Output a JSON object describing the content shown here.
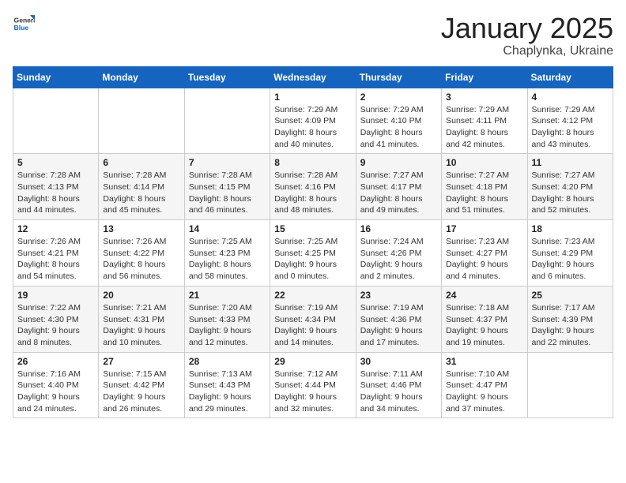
{
  "header": {
    "logo_general": "General",
    "logo_blue": "Blue",
    "month_year": "January 2025",
    "location": "Chaplynka, Ukraine"
  },
  "days_of_week": [
    "Sunday",
    "Monday",
    "Tuesday",
    "Wednesday",
    "Thursday",
    "Friday",
    "Saturday"
  ],
  "weeks": [
    [
      {
        "day": "",
        "info": ""
      },
      {
        "day": "",
        "info": ""
      },
      {
        "day": "",
        "info": ""
      },
      {
        "day": "1",
        "info": "Sunrise: 7:29 AM\nSunset: 4:09 PM\nDaylight: 8 hours and 40 minutes."
      },
      {
        "day": "2",
        "info": "Sunrise: 7:29 AM\nSunset: 4:10 PM\nDaylight: 8 hours and 41 minutes."
      },
      {
        "day": "3",
        "info": "Sunrise: 7:29 AM\nSunset: 4:11 PM\nDaylight: 8 hours and 42 minutes."
      },
      {
        "day": "4",
        "info": "Sunrise: 7:29 AM\nSunset: 4:12 PM\nDaylight: 8 hours and 43 minutes."
      }
    ],
    [
      {
        "day": "5",
        "info": "Sunrise: 7:28 AM\nSunset: 4:13 PM\nDaylight: 8 hours and 44 minutes."
      },
      {
        "day": "6",
        "info": "Sunrise: 7:28 AM\nSunset: 4:14 PM\nDaylight: 8 hours and 45 minutes."
      },
      {
        "day": "7",
        "info": "Sunrise: 7:28 AM\nSunset: 4:15 PM\nDaylight: 8 hours and 46 minutes."
      },
      {
        "day": "8",
        "info": "Sunrise: 7:28 AM\nSunset: 4:16 PM\nDaylight: 8 hours and 48 minutes."
      },
      {
        "day": "9",
        "info": "Sunrise: 7:27 AM\nSunset: 4:17 PM\nDaylight: 8 hours and 49 minutes."
      },
      {
        "day": "10",
        "info": "Sunrise: 7:27 AM\nSunset: 4:18 PM\nDaylight: 8 hours and 51 minutes."
      },
      {
        "day": "11",
        "info": "Sunrise: 7:27 AM\nSunset: 4:20 PM\nDaylight: 8 hours and 52 minutes."
      }
    ],
    [
      {
        "day": "12",
        "info": "Sunrise: 7:26 AM\nSunset: 4:21 PM\nDaylight: 8 hours and 54 minutes."
      },
      {
        "day": "13",
        "info": "Sunrise: 7:26 AM\nSunset: 4:22 PM\nDaylight: 8 hours and 56 minutes."
      },
      {
        "day": "14",
        "info": "Sunrise: 7:25 AM\nSunset: 4:23 PM\nDaylight: 8 hours and 58 minutes."
      },
      {
        "day": "15",
        "info": "Sunrise: 7:25 AM\nSunset: 4:25 PM\nDaylight: 9 hours and 0 minutes."
      },
      {
        "day": "16",
        "info": "Sunrise: 7:24 AM\nSunset: 4:26 PM\nDaylight: 9 hours and 2 minutes."
      },
      {
        "day": "17",
        "info": "Sunrise: 7:23 AM\nSunset: 4:27 PM\nDaylight: 9 hours and 4 minutes."
      },
      {
        "day": "18",
        "info": "Sunrise: 7:23 AM\nSunset: 4:29 PM\nDaylight: 9 hours and 6 minutes."
      }
    ],
    [
      {
        "day": "19",
        "info": "Sunrise: 7:22 AM\nSunset: 4:30 PM\nDaylight: 9 hours and 8 minutes."
      },
      {
        "day": "20",
        "info": "Sunrise: 7:21 AM\nSunset: 4:31 PM\nDaylight: 9 hours and 10 minutes."
      },
      {
        "day": "21",
        "info": "Sunrise: 7:20 AM\nSunset: 4:33 PM\nDaylight: 9 hours and 12 minutes."
      },
      {
        "day": "22",
        "info": "Sunrise: 7:19 AM\nSunset: 4:34 PM\nDaylight: 9 hours and 14 minutes."
      },
      {
        "day": "23",
        "info": "Sunrise: 7:19 AM\nSunset: 4:36 PM\nDaylight: 9 hours and 17 minutes."
      },
      {
        "day": "24",
        "info": "Sunrise: 7:18 AM\nSunset: 4:37 PM\nDaylight: 9 hours and 19 minutes."
      },
      {
        "day": "25",
        "info": "Sunrise: 7:17 AM\nSunset: 4:39 PM\nDaylight: 9 hours and 22 minutes."
      }
    ],
    [
      {
        "day": "26",
        "info": "Sunrise: 7:16 AM\nSunset: 4:40 PM\nDaylight: 9 hours and 24 minutes."
      },
      {
        "day": "27",
        "info": "Sunrise: 7:15 AM\nSunset: 4:42 PM\nDaylight: 9 hours and 26 minutes."
      },
      {
        "day": "28",
        "info": "Sunrise: 7:13 AM\nSunset: 4:43 PM\nDaylight: 9 hours and 29 minutes."
      },
      {
        "day": "29",
        "info": "Sunrise: 7:12 AM\nSunset: 4:44 PM\nDaylight: 9 hours and 32 minutes."
      },
      {
        "day": "30",
        "info": "Sunrise: 7:11 AM\nSunset: 4:46 PM\nDaylight: 9 hours and 34 minutes."
      },
      {
        "day": "31",
        "info": "Sunrise: 7:10 AM\nSunset: 4:47 PM\nDaylight: 9 hours and 37 minutes."
      },
      {
        "day": "",
        "info": ""
      }
    ]
  ]
}
